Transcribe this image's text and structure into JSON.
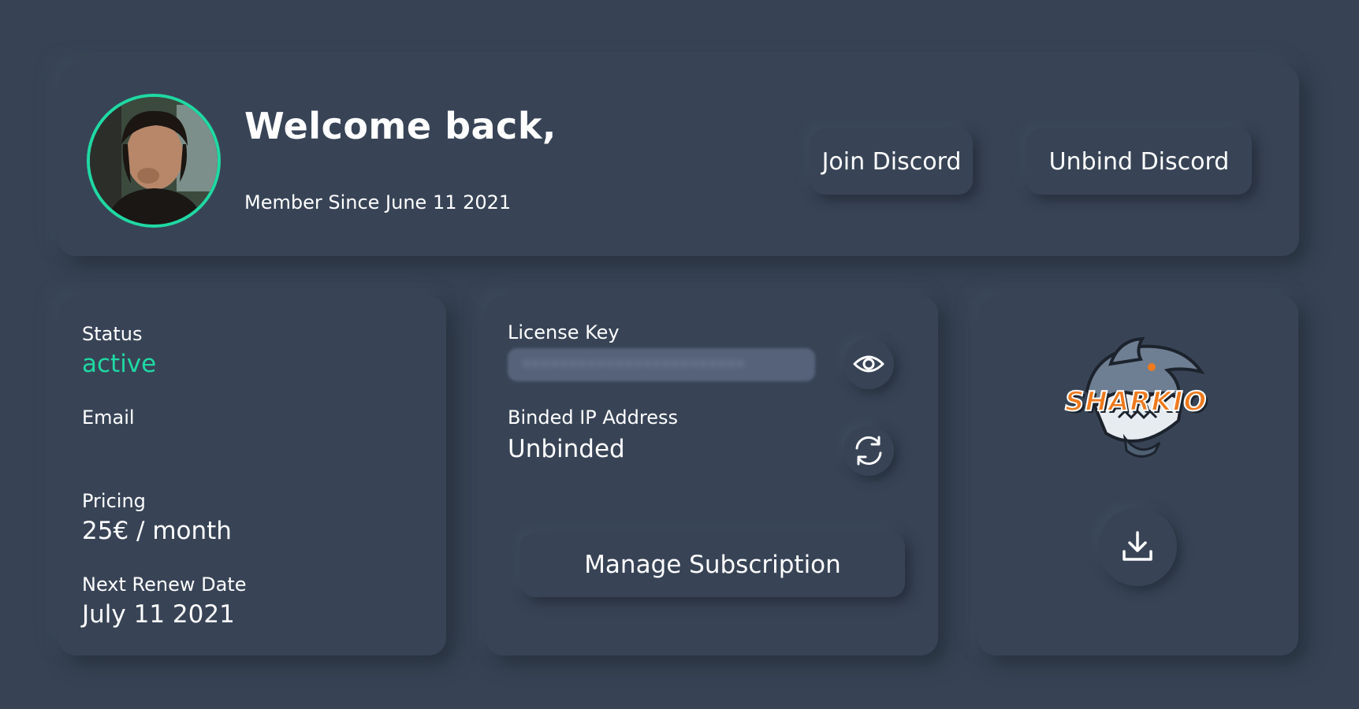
{
  "header": {
    "welcome_text": "Welcome back,",
    "member_since": "Member Since June 11 2021",
    "join_discord_label": "Join Discord",
    "unbind_discord_label": "Unbind Discord",
    "avatar_border_color": "#1fd9a3"
  },
  "account": {
    "status_label": "Status",
    "status_value": "active",
    "email_label": "Email",
    "pricing_label": "Pricing",
    "pricing_value": "25€ / month",
    "renew_label": "Next Renew Date",
    "renew_value": "July 11 2021"
  },
  "license": {
    "key_label": "License Key",
    "ip_label": "Binded IP Address",
    "ip_value": "Unbinded",
    "manage_button_label": "Manage Subscription",
    "reveal_icon": "eye-icon",
    "rebind_icon": "refresh-icon"
  },
  "download": {
    "logo_text": "SHARKIO",
    "download_icon": "download-icon"
  },
  "colors": {
    "background": "#374354",
    "accent": "#1fd9a3",
    "logo_orange": "#f07a1e"
  }
}
